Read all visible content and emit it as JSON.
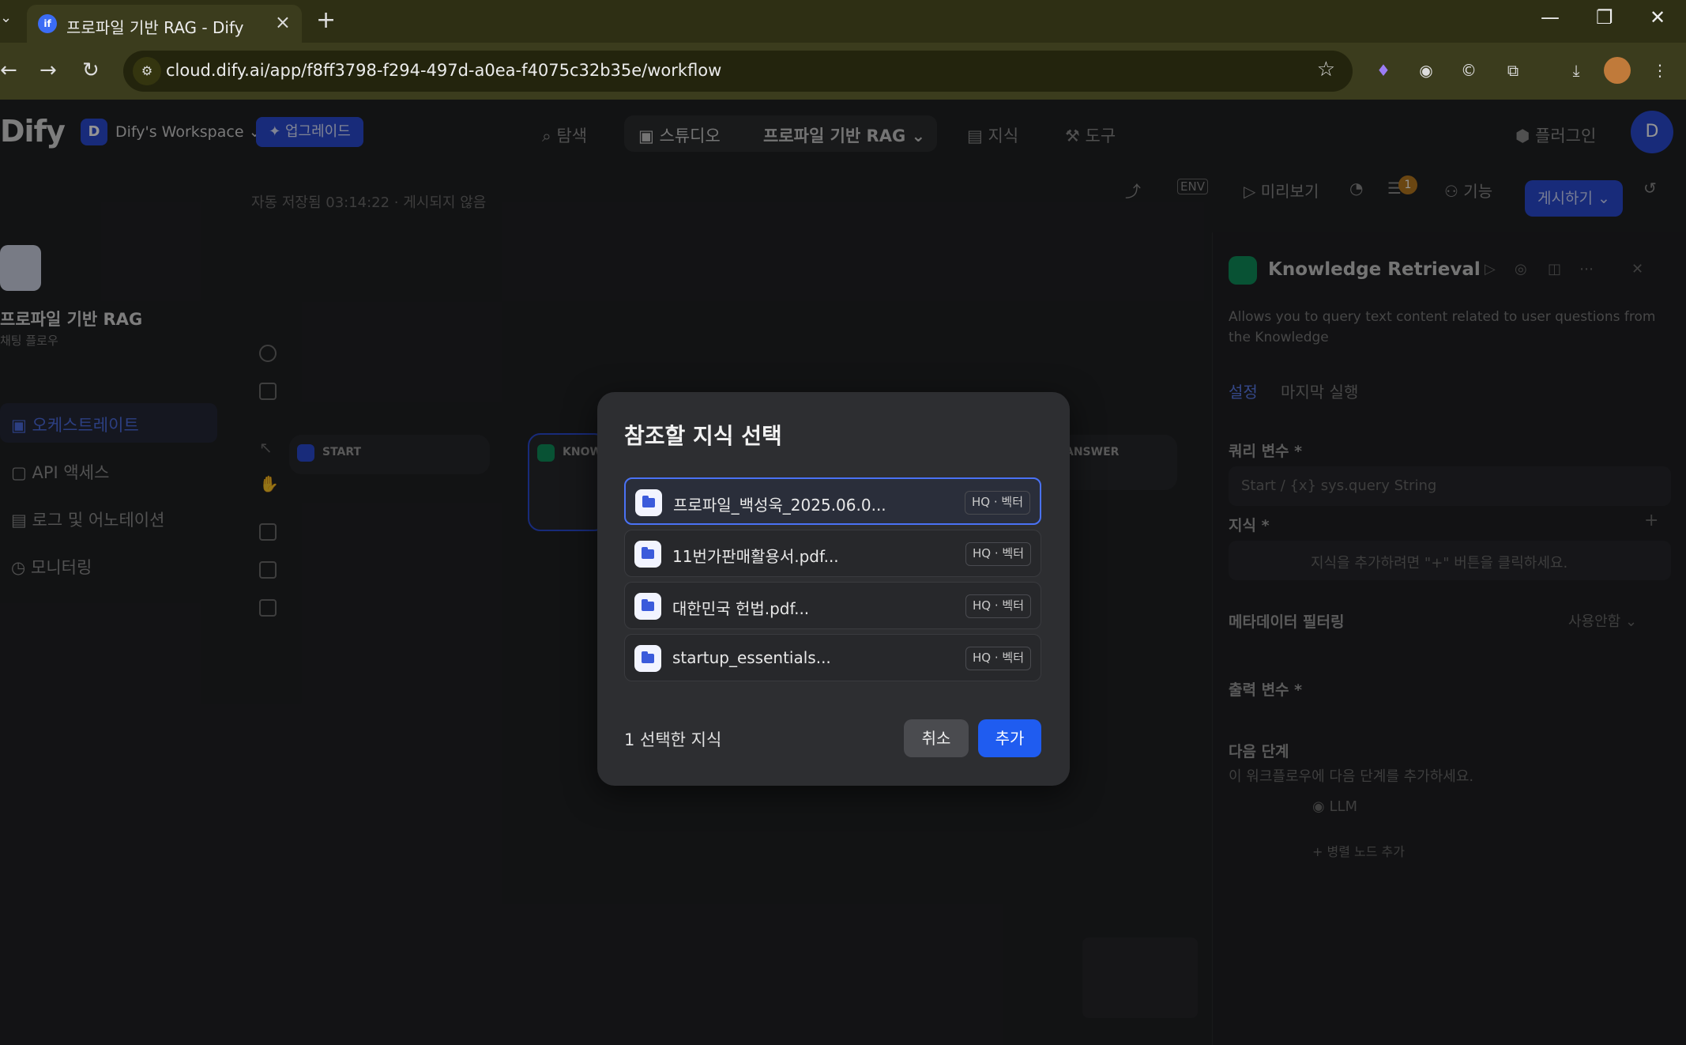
{
  "browser": {
    "tab_title": "프로파일 기반 RAG - Dify",
    "favicon_text": "if",
    "url": "cloud.dify.ai/app/f8ff3798-f294-497d-a0ea-f4075c32b35e/workflow"
  },
  "app": {
    "logo": "Dify",
    "workspace_initial": "D",
    "workspace_name": "Dify's Workspace",
    "upgrade_label": "✦ 업그레이드",
    "nav": {
      "explore": "탐색",
      "studio": "스튜디오",
      "app_name": "프로파일 기반 RAG",
      "knowledge": "지식",
      "tools": "도구",
      "plugins": "플러그인"
    },
    "user_initial": "D",
    "left": {
      "app_title": "프로파일 기반 RAG",
      "app_subtitle": "채팅 플로우",
      "items": [
        "오케스트레이트",
        "API 액세스",
        "로그 및 어노테이션",
        "모니터링"
      ]
    },
    "save_status": "자동 저장됨 03:14:22 · 게시되지 않음",
    "actions": {
      "env": "ENV",
      "preview": "미리보기",
      "features": "기능",
      "publish": "게시하기",
      "badge": "1"
    },
    "nodes": {
      "start": "START",
      "knowledge": "KNOW",
      "answer": "ANSWER"
    },
    "panel": {
      "title": "Knowledge Retrieval",
      "description": "Allows you to query text content related to user questions from the Knowledge",
      "tab_settings": "설정",
      "tab_last_run": "마지막 실행",
      "query_var_label": "쿼리 변수 *",
      "query_var_value": "Start / {x} sys.query String",
      "knowledge_label": "지식 *",
      "knowledge_hint": "지식을 추가하려면 \"+\" 버튼을 클릭하세요.",
      "metadata_label": "메타데이터 필터링",
      "metadata_value": "사용안함",
      "output_label": "출력 변수 *",
      "next_step_label": "다음 단계",
      "next_step_hint": "이 워크플로우에 다음 단계를 추가하세요.",
      "next_node": "LLM",
      "add_parallel": "+ 병렬 노드 추가"
    }
  },
  "modal": {
    "title": "참조할 지식 선택",
    "items": [
      {
        "name": "프로파일_백성욱_2025.06.0...",
        "tag": "HQ · 벡터",
        "selected": true
      },
      {
        "name": "11번가판매활용서.pdf...",
        "tag": "HQ · 벡터",
        "selected": false
      },
      {
        "name": "대한민국 헌법.pdf...",
        "tag": "HQ · 벡터",
        "selected": false
      },
      {
        "name": "startup_essentials...",
        "tag": "HQ · 벡터",
        "selected": false
      }
    ],
    "selected_count": "1 선택한 지식",
    "cancel": "취소",
    "add": "추가"
  },
  "colors": {
    "accent": "#1f5cf0",
    "selected_border": "#4a72f5"
  }
}
